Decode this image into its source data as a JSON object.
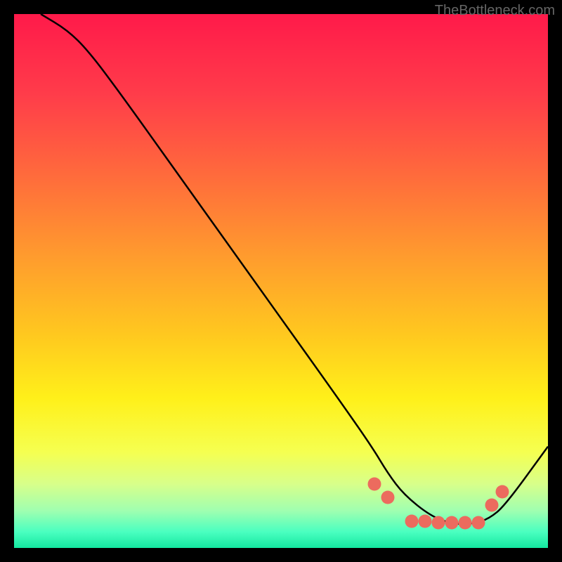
{
  "watermark": "TheBottleneck.com",
  "chart_data": {
    "type": "line",
    "title": "",
    "xlabel": "",
    "ylabel": "",
    "xlim": [
      0,
      100
    ],
    "ylim": [
      0,
      100
    ],
    "series": [
      {
        "name": "curve",
        "x": [
          5,
          10,
          14,
          20,
          30,
          40,
          50,
          60,
          67,
          70,
          73,
          78,
          82,
          86,
          89,
          92,
          100
        ],
        "y": [
          100,
          97,
          93,
          85,
          71,
          57,
          43,
          29,
          19,
          14,
          10,
          6,
          4.5,
          4.5,
          5.5,
          8,
          19
        ]
      }
    ],
    "markers": {
      "name": "dots",
      "x": [
        67.5,
        70,
        74.5,
        77,
        79.5,
        82,
        84.5,
        87,
        89.5,
        91.5
      ],
      "y": [
        12,
        9.5,
        5,
        5,
        4.8,
        4.8,
        4.8,
        4.8,
        8,
        10.5
      ],
      "color": "#ec6b5e"
    },
    "gradient_stops": [
      {
        "pos": 0.0,
        "color": "#ff1a4a"
      },
      {
        "pos": 0.15,
        "color": "#ff3c4a"
      },
      {
        "pos": 0.3,
        "color": "#ff6a3c"
      },
      {
        "pos": 0.45,
        "color": "#ff9a2e"
      },
      {
        "pos": 0.6,
        "color": "#ffc81f"
      },
      {
        "pos": 0.72,
        "color": "#fff01a"
      },
      {
        "pos": 0.82,
        "color": "#f5ff50"
      },
      {
        "pos": 0.88,
        "color": "#d8ff8a"
      },
      {
        "pos": 0.93,
        "color": "#a0ffb0"
      },
      {
        "pos": 0.97,
        "color": "#4affc0"
      },
      {
        "pos": 1.0,
        "color": "#14e8a0"
      }
    ]
  }
}
